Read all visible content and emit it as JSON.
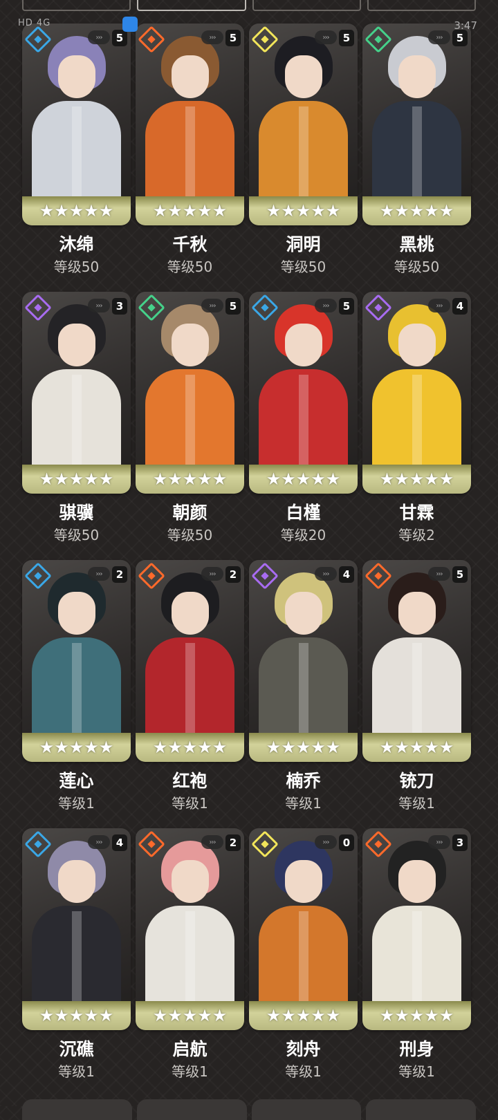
{
  "tabs": [
    "",
    "",
    "",
    ""
  ],
  "status_bar": {
    "left": "HD 4G",
    "right": "3:47"
  },
  "card_common": {
    "stars": "★★★★★",
    "potential_icon": "›››"
  },
  "characters": [
    {
      "name": "沐绵",
      "level": "等级50",
      "rank": "5",
      "attr_color": "#3aa7e6",
      "hair": "#8a82b8",
      "outfit": "#cfd3da"
    },
    {
      "name": "千秋",
      "level": "等级50",
      "rank": "5",
      "attr_color": "#ff6a2b",
      "hair": "#8a5a32",
      "outfit": "#d8692a"
    },
    {
      "name": "洞明",
      "level": "等级50",
      "rank": "5",
      "attr_color": "#f2e55a",
      "hair": "#1d1d22",
      "outfit": "#d98a2e"
    },
    {
      "name": "黑桃",
      "level": "等级50",
      "rank": "5",
      "attr_color": "#45d18a",
      "hair": "#c9cbd1",
      "outfit": "#2e3542"
    },
    {
      "name": "骐骥",
      "level": "等级50",
      "rank": "3",
      "attr_color": "#a86cf0",
      "hair": "#242326",
      "outfit": "#e6e2da"
    },
    {
      "name": "朝颜",
      "level": "等级50",
      "rank": "5",
      "attr_color": "#45d18a",
      "hair": "#a6896a",
      "outfit": "#e3772e"
    },
    {
      "name": "白槿",
      "level": "等级20",
      "rank": "5",
      "attr_color": "#3aa7e6",
      "hair": "#d8342a",
      "outfit": "#c72e2e"
    },
    {
      "name": "甘霖",
      "level": "等级2",
      "rank": "4",
      "attr_color": "#a86cf0",
      "hair": "#e8c030",
      "outfit": "#f0c22e"
    },
    {
      "name": "莲心",
      "level": "等级1",
      "rank": "2",
      "attr_color": "#3aa7e6",
      "hair": "#1f2a2e",
      "outfit": "#3f6f7a"
    },
    {
      "name": "红袍",
      "level": "等级1",
      "rank": "2",
      "attr_color": "#ff6a2b",
      "hair": "#1d1d20",
      "outfit": "#b3262c"
    },
    {
      "name": "楠乔",
      "level": "等级1",
      "rank": "4",
      "attr_color": "#a86cf0",
      "hair": "#cfc27c",
      "outfit": "#5b5a52"
    },
    {
      "name": "铳刀",
      "level": "等级1",
      "rank": "5",
      "attr_color": "#ff6a2b",
      "hair": "#2a1d1a",
      "outfit": "#e4e0da"
    },
    {
      "name": "沉礁",
      "level": "等级1",
      "rank": "4",
      "attr_color": "#3aa7e6",
      "hair": "#8f8aa8",
      "outfit": "#2a2a30"
    },
    {
      "name": "启航",
      "level": "等级1",
      "rank": "2",
      "attr_color": "#ff6a2b",
      "hair": "#e59a9a",
      "outfit": "#e6e3dc"
    },
    {
      "name": "刻舟",
      "level": "等级1",
      "rank": "0",
      "attr_color": "#f2e55a",
      "hair": "#2e3660",
      "outfit": "#d3772c"
    },
    {
      "name": "刑身",
      "level": "等级1",
      "rank": "3",
      "attr_color": "#ff6a2b",
      "hair": "#222",
      "outfit": "#e8e4d8"
    }
  ]
}
